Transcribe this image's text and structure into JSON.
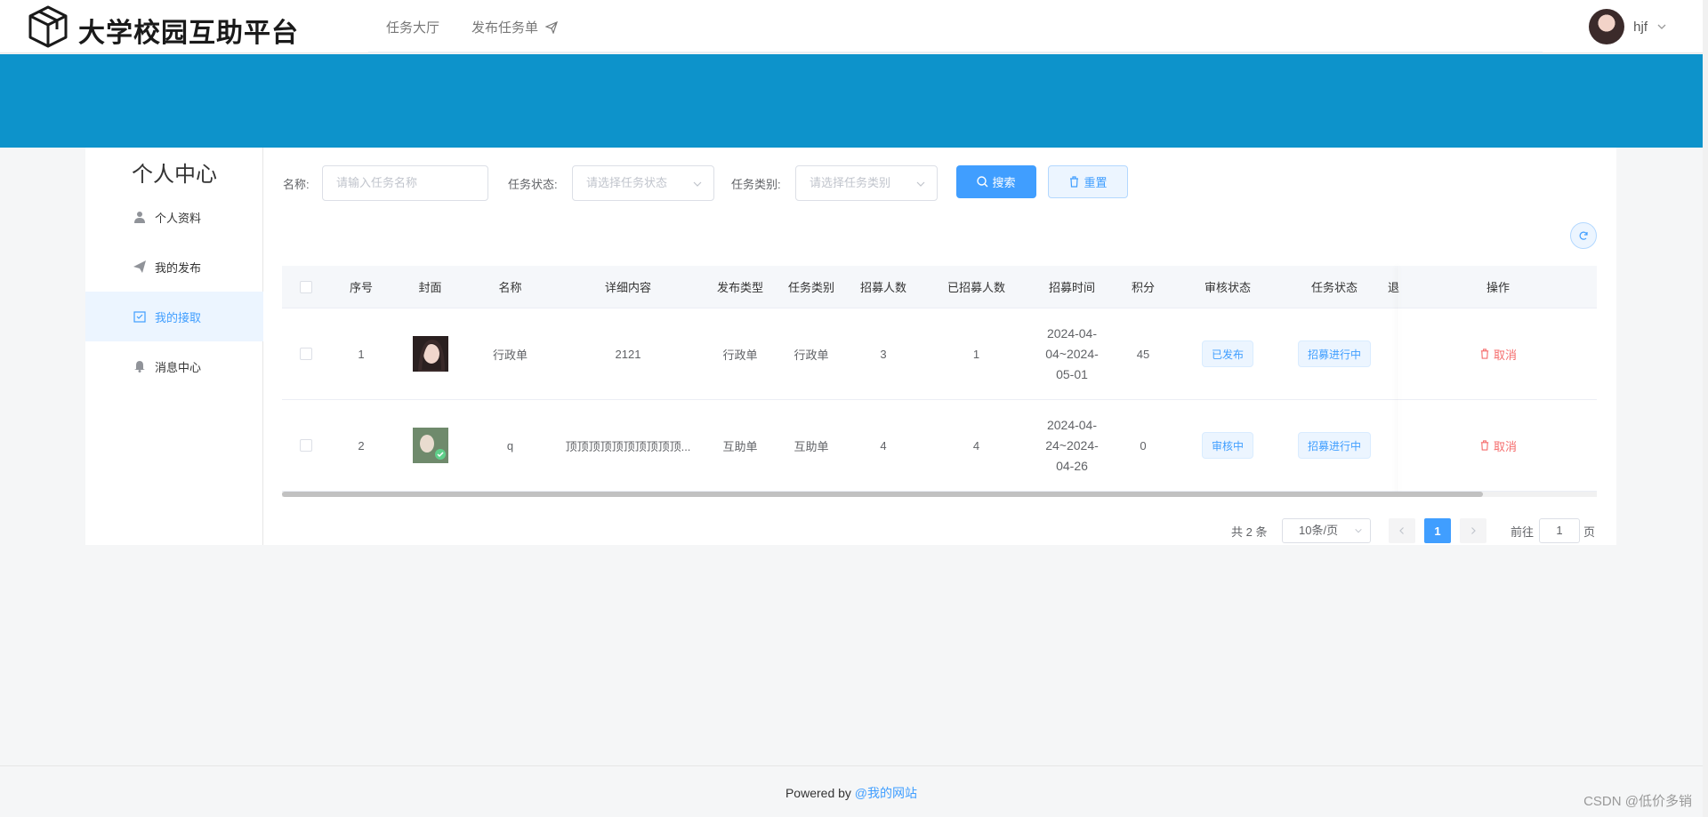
{
  "header": {
    "brand": "大学校园互助平台",
    "nav": {
      "task_hall": "任务大厅",
      "publish_task": "发布任务单"
    },
    "user": {
      "name": "hjf"
    }
  },
  "sidebar": {
    "title": "个人中心",
    "items": [
      {
        "label": "个人资料",
        "icon": "user-icon"
      },
      {
        "label": "我的发布",
        "icon": "paper-plane-icon"
      },
      {
        "label": "我的接取",
        "icon": "checkbox-icon",
        "active": true
      },
      {
        "label": "消息中心",
        "icon": "bell-icon"
      }
    ]
  },
  "filters": {
    "name_label": "名称:",
    "name_placeholder": "请输入任务名称",
    "status_label": "任务状态:",
    "status_placeholder": "请选择任务状态",
    "category_label": "任务类别:",
    "category_placeholder": "请选择任务类别",
    "search_label": "搜索",
    "reset_label": "重置"
  },
  "table": {
    "columns": [
      "序号",
      "封面",
      "名称",
      "详细内容",
      "发布类型",
      "任务类别",
      "招募人数",
      "已招募人数",
      "招募时间",
      "积分",
      "审核状态",
      "任务状态",
      "退",
      "操作"
    ],
    "rows": [
      {
        "index": "1",
        "name": "行政单",
        "detail": "2121",
        "publish_type": "行政单",
        "category": "行政单",
        "recruit": "3",
        "recruited": "1",
        "time": "2024-04-04~2024-05-01",
        "points": "45",
        "audit": "已发布",
        "status": "招募进行中",
        "action": "取消"
      },
      {
        "index": "2",
        "name": "q",
        "detail": "顶顶顶顶顶顶顶顶顶顶...",
        "publish_type": "互助单",
        "category": "互助单",
        "recruit": "4",
        "recruited": "4",
        "time": "2024-04-24~2024-04-26",
        "points": "0",
        "audit": "审核中",
        "status": "招募进行中",
        "action": "取消"
      }
    ]
  },
  "pagination": {
    "total": "共 2 条",
    "page_size": "10条/页",
    "current": "1",
    "goto_label": "前往",
    "goto_value": "1",
    "page_suffix": "页"
  },
  "footer": {
    "powered": "Powered by",
    "link": "@我的网站"
  },
  "watermark": "CSDN @低价多销",
  "colors": {
    "banner": "#0d93cb",
    "primary": "#409eff",
    "danger": "#f56c6c"
  }
}
